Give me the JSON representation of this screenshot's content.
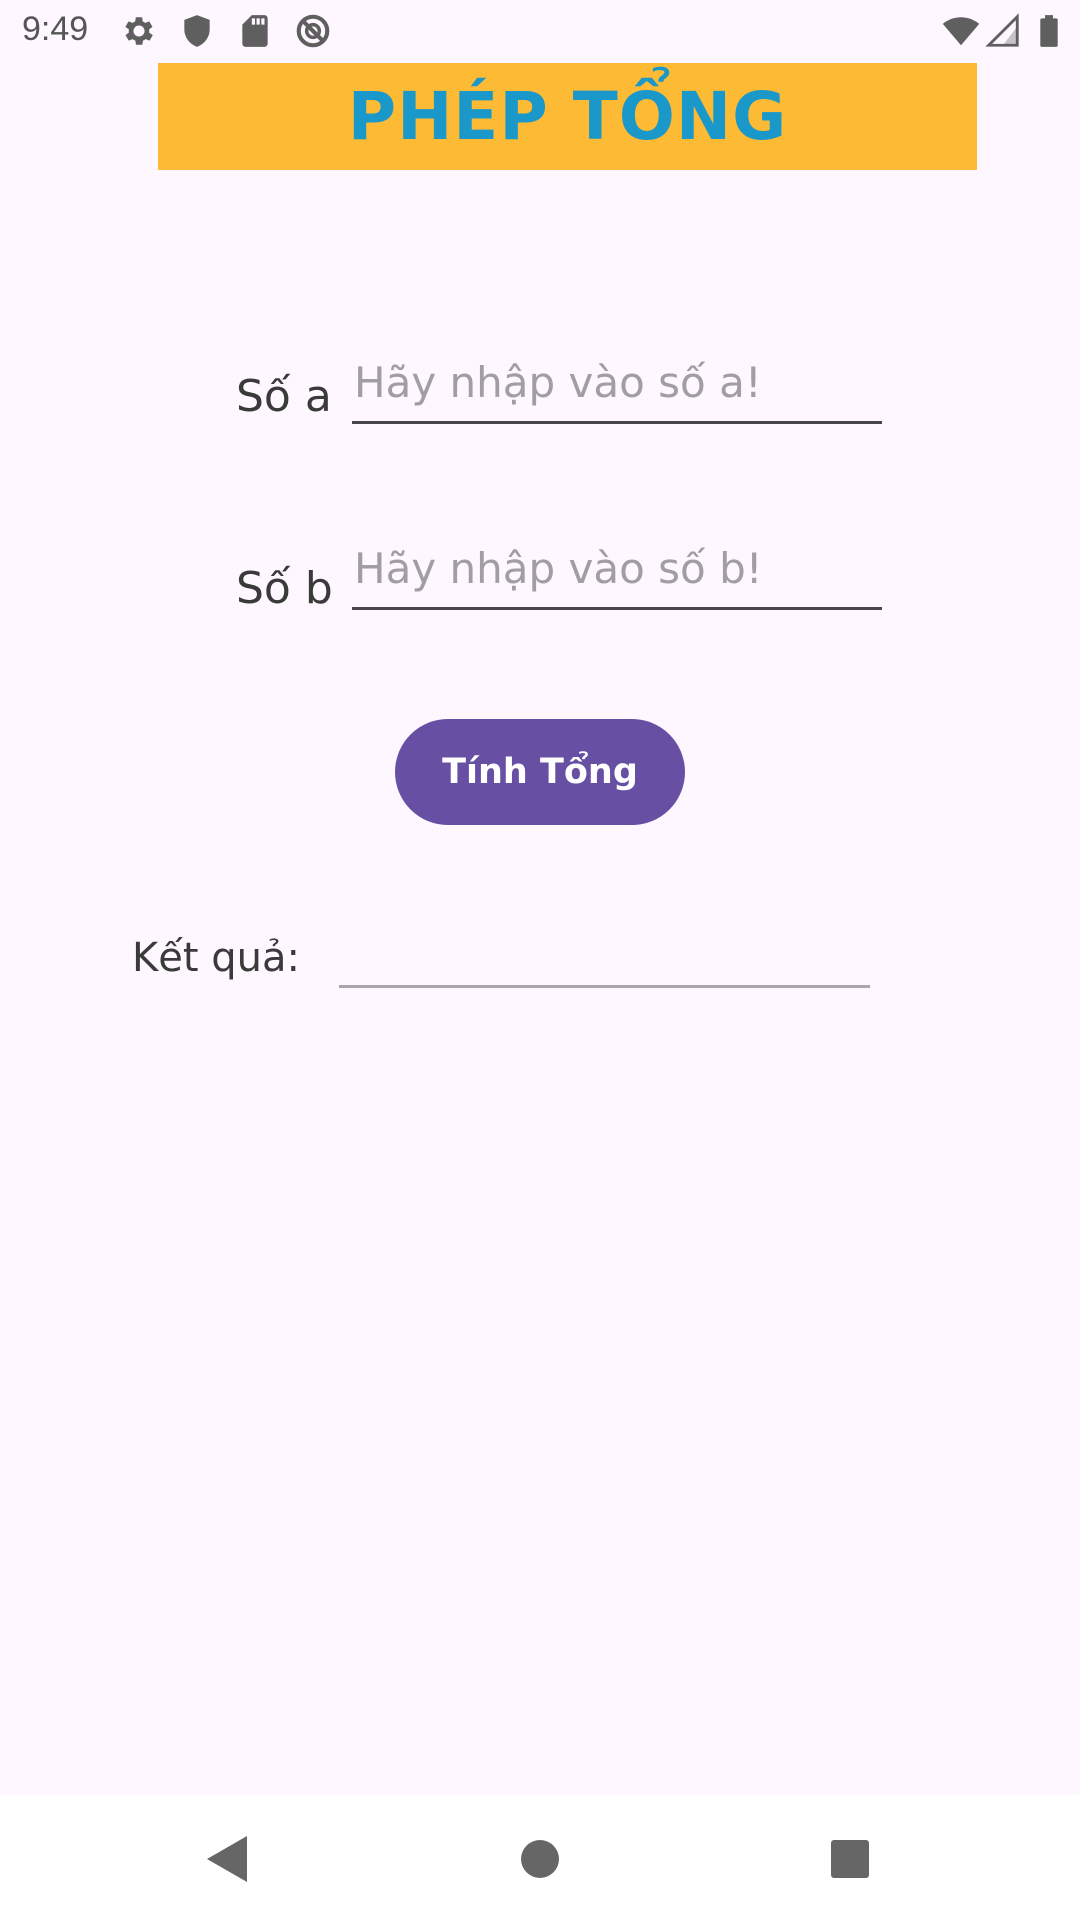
{
  "status_bar": {
    "time": "9:49",
    "icons_left": [
      "gear-icon",
      "shield-icon",
      "sd-card-icon",
      "no-sync-icon"
    ],
    "icons_right": [
      "wifi-icon",
      "cellular-icon",
      "battery-icon"
    ]
  },
  "header": {
    "title": "PHÉP TỔNG",
    "background_color": "#FDBB35",
    "text_color": "#1998C9"
  },
  "form": {
    "field_a": {
      "label": "Số a",
      "placeholder": "Hãy nhập vào số a!",
      "value": ""
    },
    "field_b": {
      "label": "Số b",
      "placeholder": "Hãy nhập vào số b!",
      "value": ""
    },
    "button_label": "Tính Tổng",
    "button_color": "#6750A4",
    "result_label": "Kết quả:",
    "result_value": ""
  },
  "nav_bar": {
    "buttons": [
      "back-icon",
      "home-icon",
      "recents-icon"
    ]
  }
}
